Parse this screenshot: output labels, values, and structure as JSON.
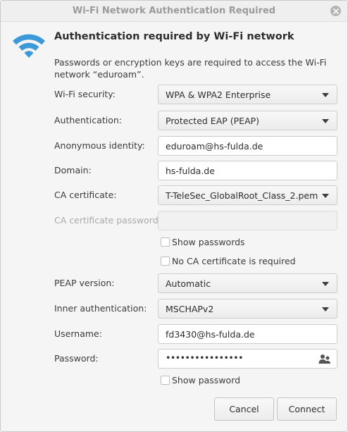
{
  "window": {
    "title": "Wi-Fi Network Authentication Required"
  },
  "header": {
    "icon": "wifi-icon",
    "heading": "Authentication required by Wi-Fi network",
    "description": "Passwords or encryption keys are required to access the Wi-Fi network “eduroam”."
  },
  "form": {
    "wifi_security": {
      "label": "Wi-Fi security:",
      "value": "WPA & WPA2 Enterprise"
    },
    "authentication": {
      "label": "Authentication:",
      "value": "Protected EAP (PEAP)"
    },
    "anonymous_identity": {
      "label": "Anonymous identity:",
      "value": "eduroam@hs-fulda.de"
    },
    "domain": {
      "label": "Domain:",
      "value": "hs-fulda.de"
    },
    "ca_certificate": {
      "label": "CA certificate:",
      "value": "T-TeleSec_GlobalRoot_Class_2.pem"
    },
    "ca_certificate_password": {
      "label": "CA certificate password:",
      "value": ""
    },
    "show_passwords": {
      "label": "Show passwords",
      "checked": false
    },
    "no_ca_certificate": {
      "label": "No CA certificate is required",
      "checked": false
    },
    "peap_version": {
      "label": "PEAP version:",
      "value": "Automatic"
    },
    "inner_authentication": {
      "label": "Inner authentication:",
      "value": "MSCHAPv2"
    },
    "username": {
      "label": "Username:",
      "value": "fd3430@hs-fulda.de"
    },
    "password": {
      "label": "Password:",
      "value": "••••••••••••••••"
    },
    "show_password": {
      "label": "Show password",
      "checked": false
    }
  },
  "buttons": {
    "cancel": "Cancel",
    "connect": "Connect"
  },
  "colors": {
    "wifi_blue": "#3d9ad8",
    "window_bg": "#f5f5f5"
  }
}
